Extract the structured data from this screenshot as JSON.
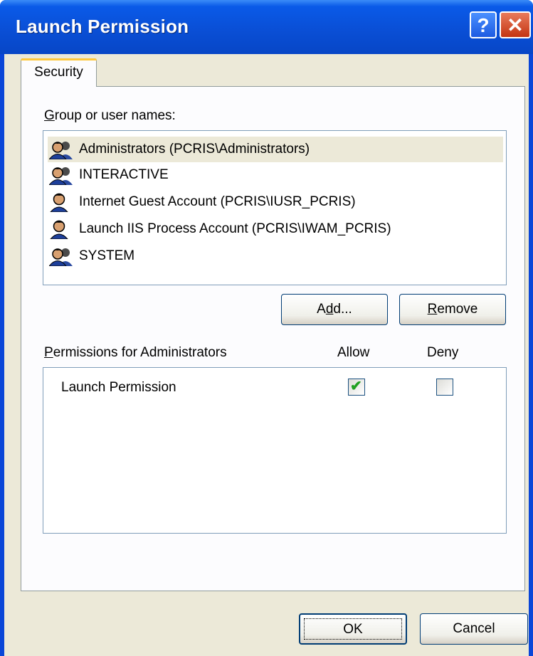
{
  "window": {
    "title": "Launch Permission"
  },
  "titlebar_buttons": {
    "help": "?",
    "close": "✕"
  },
  "tabs": [
    {
      "label": "Security"
    }
  ],
  "group_section": {
    "label_prefix": "G",
    "label_rest": "roup or user names:",
    "items": [
      {
        "label": "Administrators (PCRIS\\Administrators)",
        "icon": "group-icon"
      },
      {
        "label": "INTERACTIVE",
        "icon": "group-icon"
      },
      {
        "label": "Internet Guest Account (PCRIS\\IUSR_PCRIS)",
        "icon": "user-icon"
      },
      {
        "label": "Launch IIS Process Account (PCRIS\\IWAM_PCRIS)",
        "icon": "user-icon"
      },
      {
        "label": "SYSTEM",
        "icon": "group-icon"
      }
    ],
    "selected_index": 0
  },
  "buttons": {
    "add_pre": "A",
    "add_key": "d",
    "add_post": "d...",
    "remove_key": "R",
    "remove_post": "emove",
    "ok": "OK",
    "cancel": "Cancel"
  },
  "permissions": {
    "label_prefix": "P",
    "label_rest": "ermissions for Administrators",
    "allow_header": "Allow",
    "deny_header": "Deny",
    "rows": [
      {
        "name": "Launch Permission",
        "allow": true,
        "deny": false
      }
    ]
  },
  "colors": {
    "titlebar": "#0a4fd6",
    "dialog_bg": "#ece9d8",
    "check_green": "#21a121"
  }
}
